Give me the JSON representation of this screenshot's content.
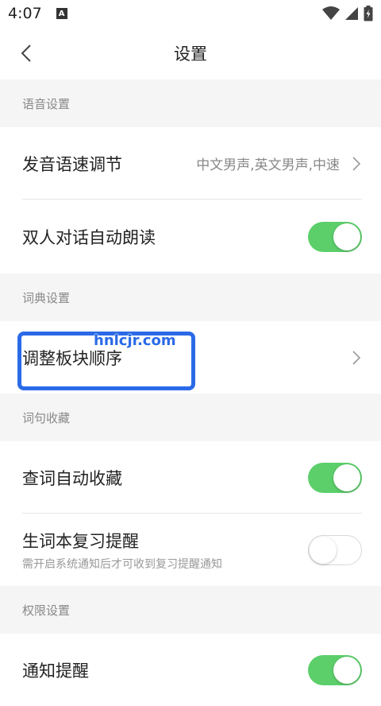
{
  "status_bar": {
    "time": "4:07",
    "notification_letter": "A"
  },
  "header": {
    "title": "设置"
  },
  "sections": {
    "voice": {
      "title": "语音设置",
      "speed_label": "发音语速调节",
      "speed_value": "中文男声,英文男声,中速",
      "auto_read_label": "双人对话自动朗读",
      "auto_read_on": true
    },
    "dictionary": {
      "title": "词典设置",
      "reorder_label": "调整板块顺序"
    },
    "collection": {
      "title": "词句收藏",
      "auto_collect_label": "查词自动收藏",
      "auto_collect_on": true,
      "review_label": "生词本复习提醒",
      "review_sub": "需开启系统通知后才可收到复习提醒通知",
      "review_on": false
    },
    "permissions": {
      "title": "权限设置",
      "notify_label": "通知提醒",
      "notify_on": true
    }
  },
  "watermark": "hnlcjr.com",
  "colors": {
    "toggle_on": "#5ccf6b",
    "highlight": "#2a6ae8"
  }
}
